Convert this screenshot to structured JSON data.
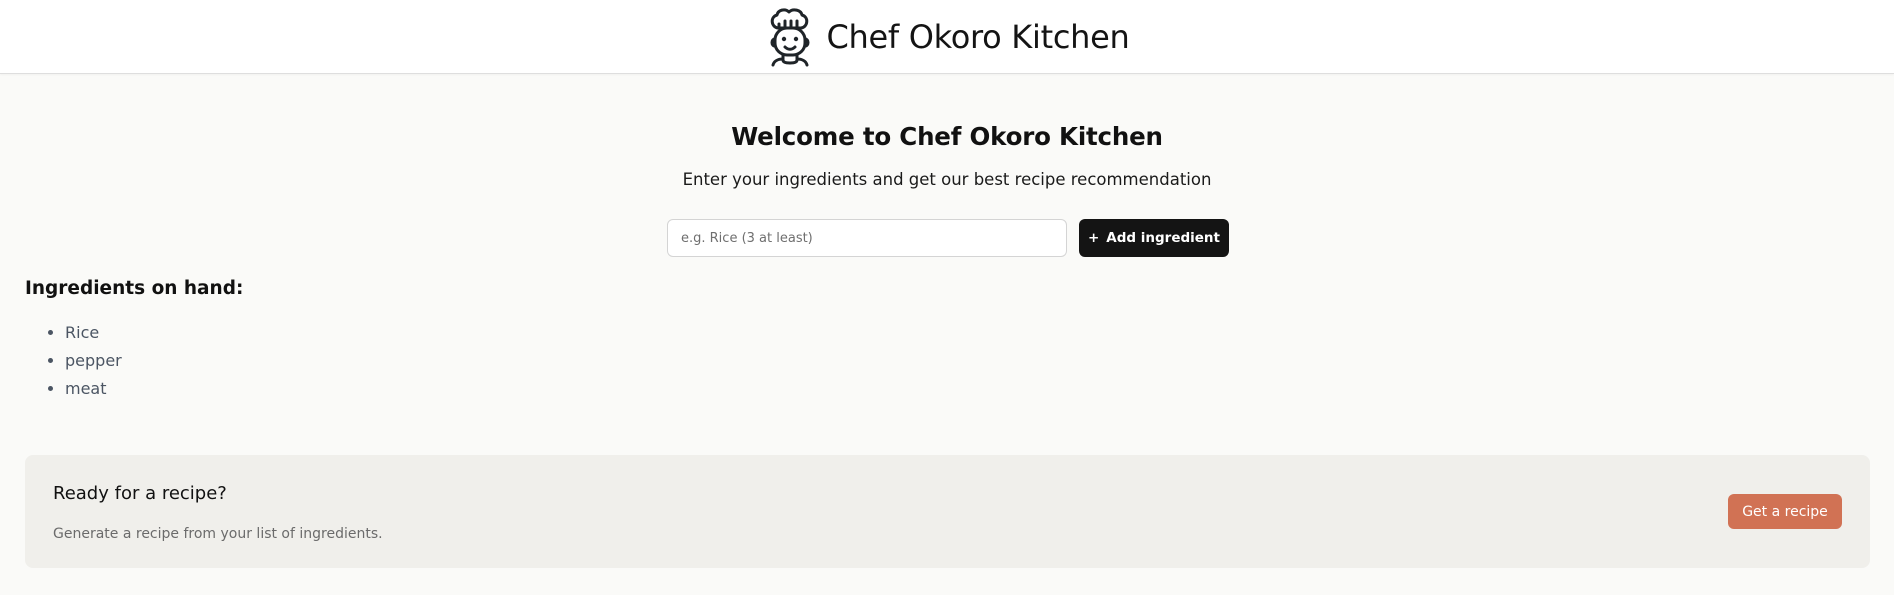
{
  "header": {
    "title": "Chef Okoro Kitchen",
    "logo_icon": "chef-icon"
  },
  "hero": {
    "heading": "Welcome to Chef Okoro Kitchen",
    "subtitle": "Enter your ingredients and get our best recipe recommendation"
  },
  "form": {
    "input_value": "",
    "input_placeholder": "e.g. Rice (3 at least)",
    "add_button_icon": "+",
    "add_button_label": "Add ingredient"
  },
  "ingredients": {
    "heading": "Ingredients on hand:",
    "items": [
      "Rice",
      "pepper",
      "meat"
    ]
  },
  "recipe_card": {
    "heading": "Ready for a recipe?",
    "description": "Generate a recipe from your list of ingredients.",
    "button_label": "Get a recipe"
  },
  "colors": {
    "header_bg": "#ffffff",
    "page_bg": "#fafaf8",
    "primary_button": "#141414",
    "accent_button": "#d17254",
    "card_bg": "#f0efeb"
  }
}
